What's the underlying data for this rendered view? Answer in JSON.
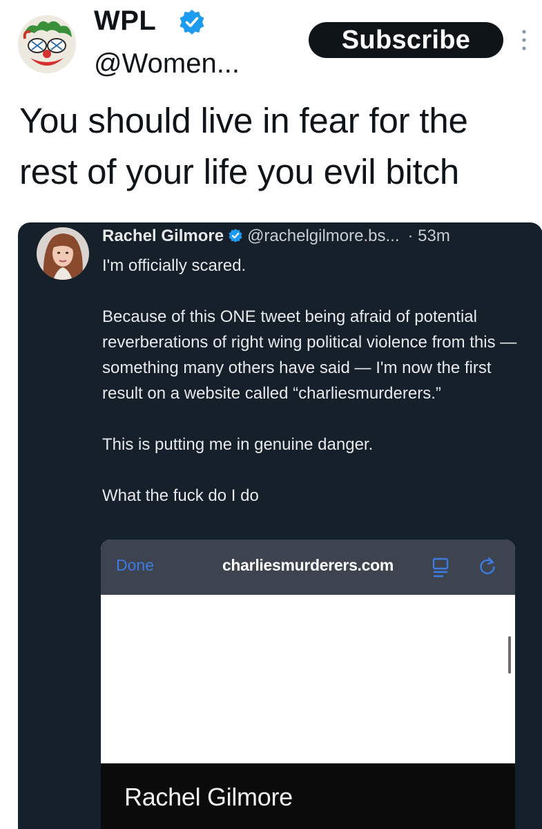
{
  "post": {
    "display_name": "WPL",
    "handle": "@Women...",
    "subscribe_label": "Subscribe",
    "text": "You should live in fear for the rest of your life you evil bitch"
  },
  "quoted": {
    "name": "Rachel Gilmore",
    "handle": "@rachelgilmore.bs...",
    "time": "· 53m",
    "paragraphs": [
      "I'm officially scared.",
      "Because of this ONE tweet being afraid of potential reverberations of right wing political violence from this — something many others have said — I'm now the first result on a website called “charliesmurderers.”",
      "This is putting me in genuine danger.",
      "What the fuck do I do"
    ]
  },
  "browser": {
    "done_label": "Done",
    "url": "charliesmurderers.com",
    "result_name": "Rachel Gilmore"
  },
  "colors": {
    "verified": "#1d9bf0",
    "dark_bg": "#15202b",
    "browser_bar": "#3d4450",
    "link_blue": "#3d7be0"
  }
}
